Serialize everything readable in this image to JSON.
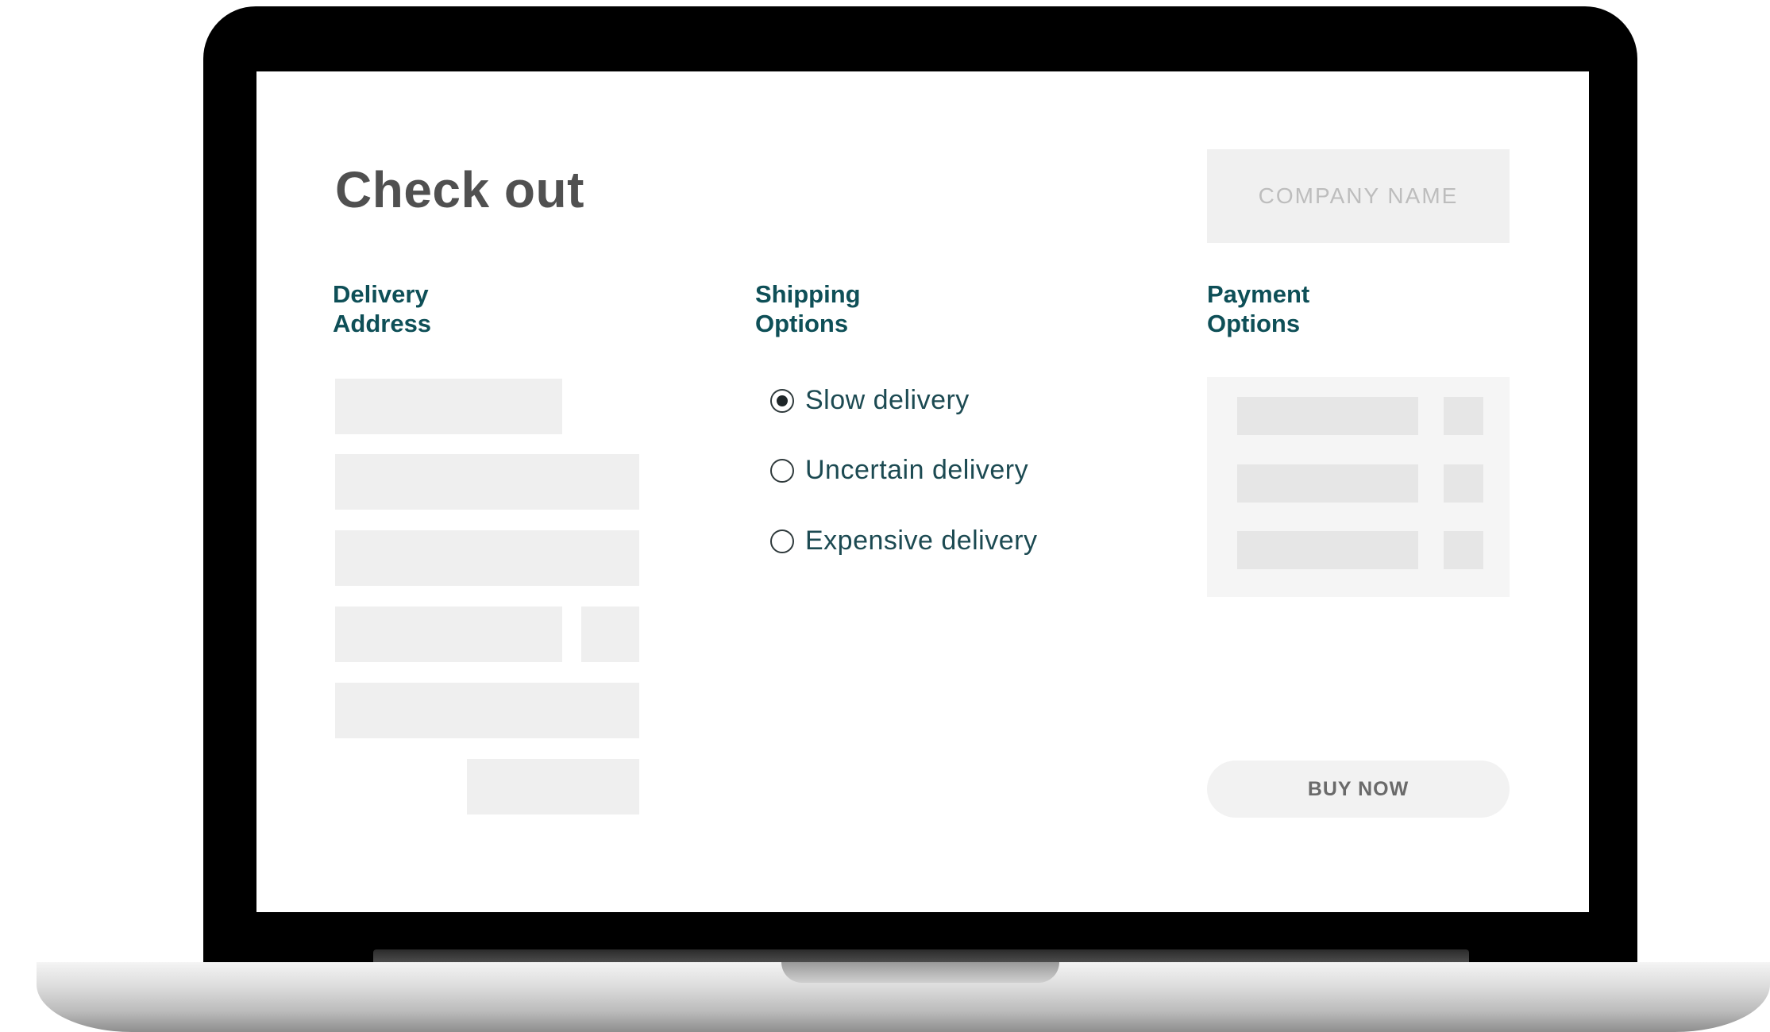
{
  "header": {
    "title": "Check out",
    "company_name": "COMPANY NAME"
  },
  "delivery": {
    "heading_line1": "Delivery",
    "heading_line2": "Address"
  },
  "shipping": {
    "heading_line1": "Shipping",
    "heading_line2": "Options",
    "options": [
      {
        "label": "Slow delivery",
        "selected": true
      },
      {
        "label": "Uncertain delivery",
        "selected": false
      },
      {
        "label": "Expensive delivery",
        "selected": false
      }
    ]
  },
  "payment": {
    "heading_line1": "Payment",
    "heading_line2": "Options"
  },
  "actions": {
    "buy_label": "BUY NOW"
  },
  "colors": {
    "accent": "#0e4f57",
    "title": "#505050",
    "placeholder": "#efefef",
    "bezel": "#000000"
  }
}
